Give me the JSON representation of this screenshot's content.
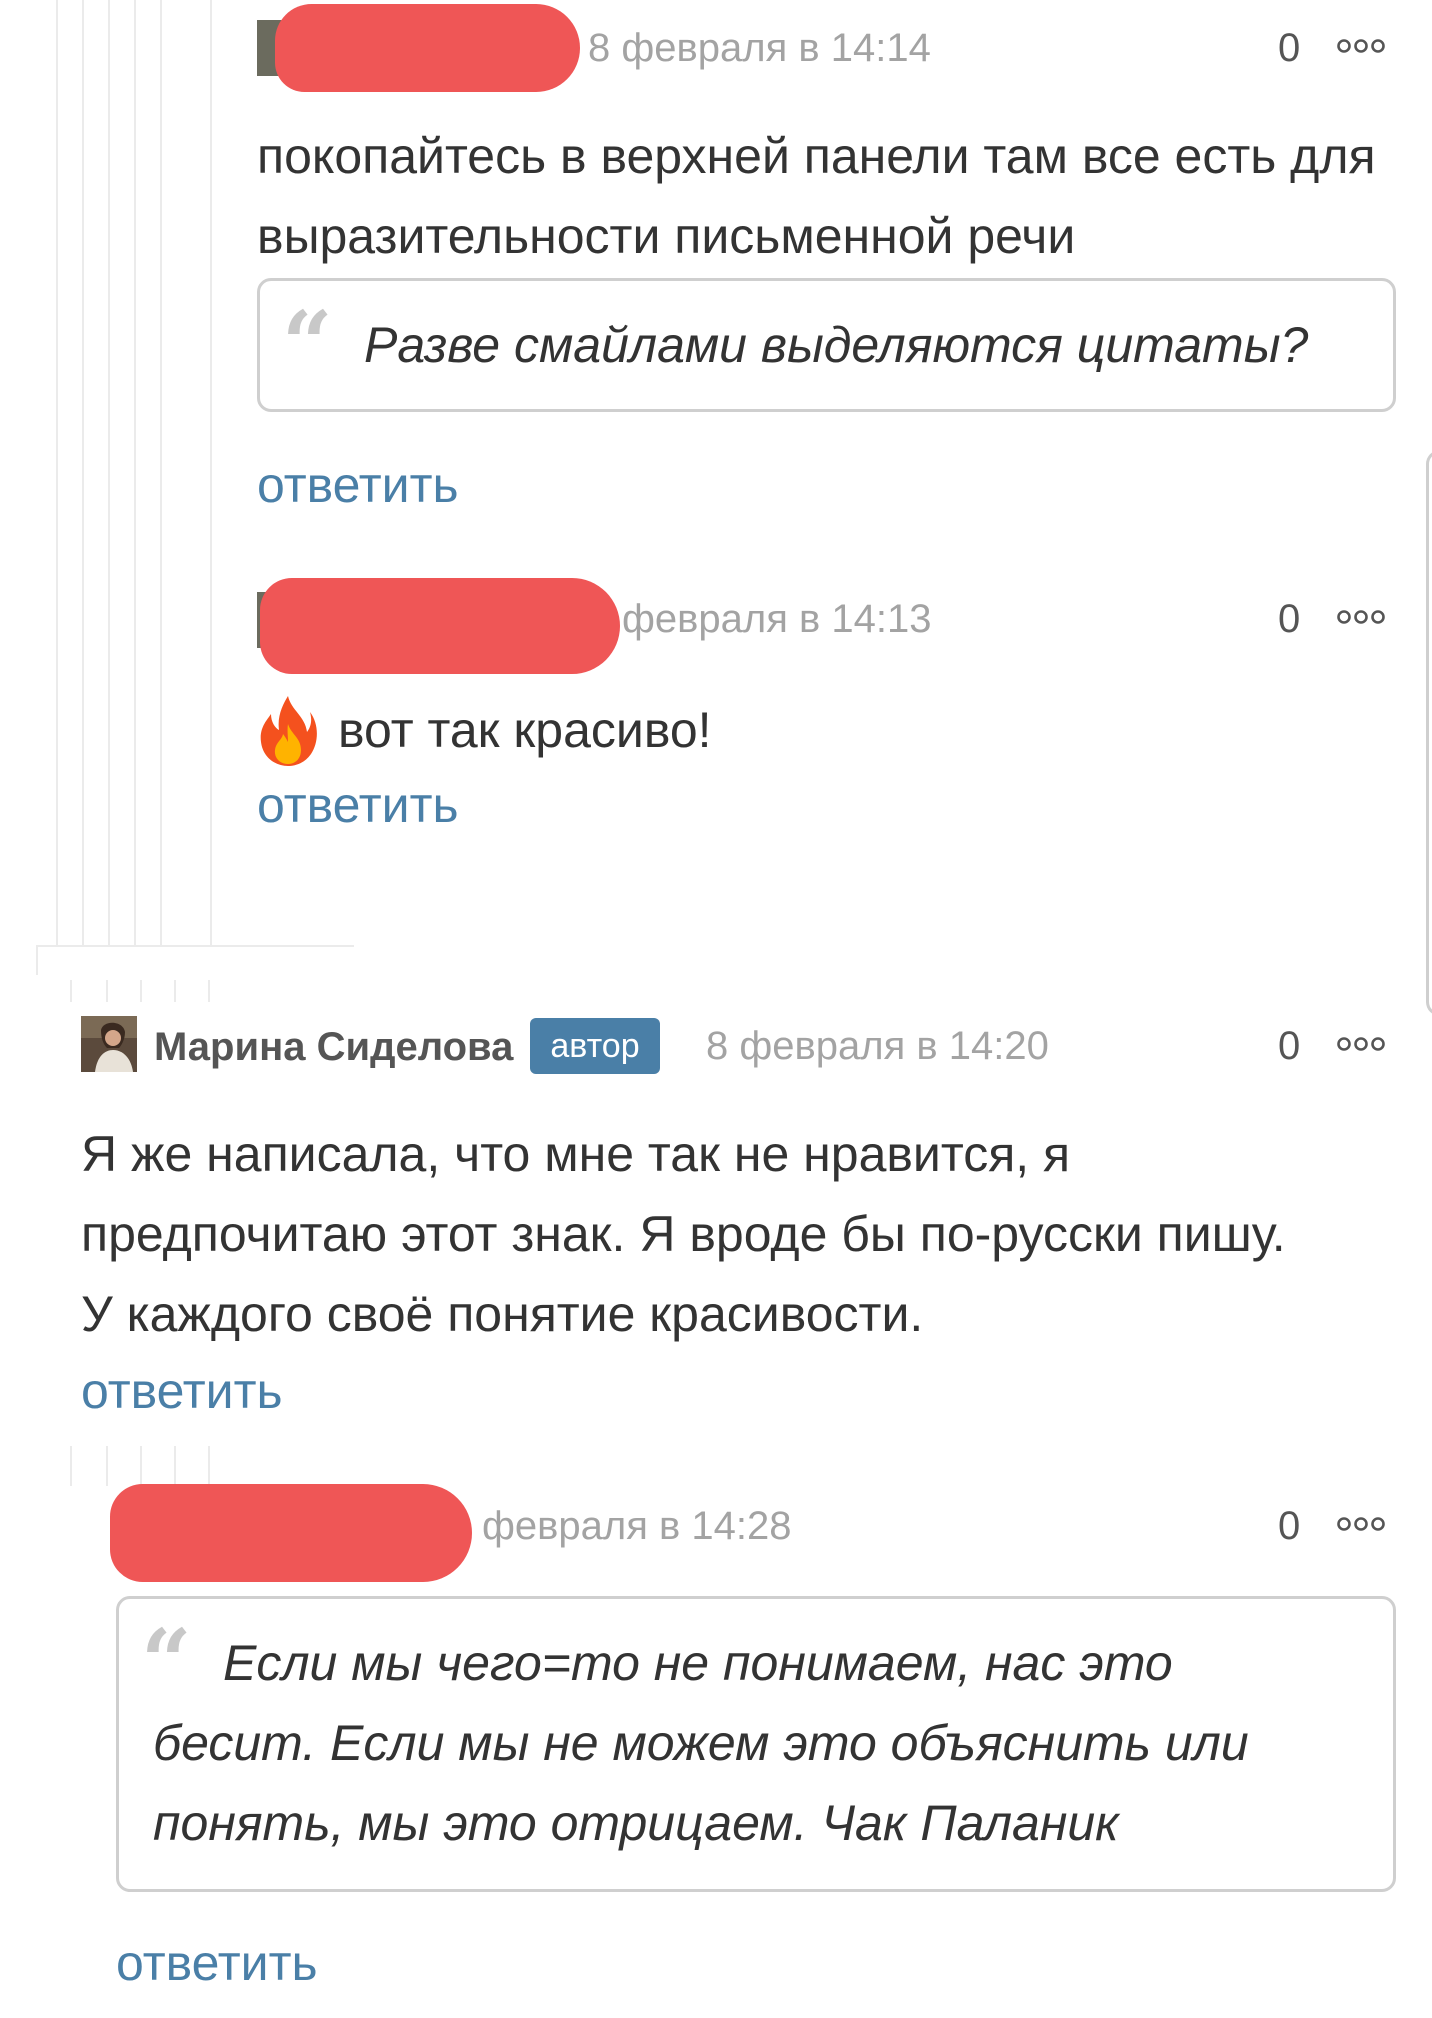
{
  "comments": [
    {
      "timestamp": "8 февраля в 14:14",
      "score": "0",
      "text": "покопайтесь в верхней панели там все есть для выразительности письменной речи",
      "quote": "Разве смайлами выделяются цитаты?",
      "reply_label": "ответить"
    },
    {
      "timestamp": "февраля в 14:13",
      "score": "0",
      "emoji": "🔥",
      "text": "вот так красиво!",
      "reply_label": "ответить"
    },
    {
      "author_name": "Марина Сиделова",
      "author_badge": "автор",
      "timestamp": "8 февраля в 14:20",
      "score": "0",
      "text": "Я же написала, что мне так не нравится, я предпочитаю этот знак. Я вроде бы по-русски пишу. У каждого своё понятие красивости.",
      "reply_label": "ответить"
    },
    {
      "timestamp": "февраля в 14:28",
      "score": "0",
      "quote": "Если мы чего=то не понимаем, нас это бесит. Если мы не можем это объяснить или понять, мы это отрицаем. Чак Паланик",
      "reply_label": "ответить"
    }
  ],
  "icons": {
    "more": "more-options-icon",
    "quote": "quote-icon",
    "fire": "fire-emoji-icon"
  },
  "colors": {
    "link": "#4a7fa7",
    "badge": "#4a7fa7",
    "redaction": "#ef5656",
    "timestamp": "#a3a3a3"
  }
}
